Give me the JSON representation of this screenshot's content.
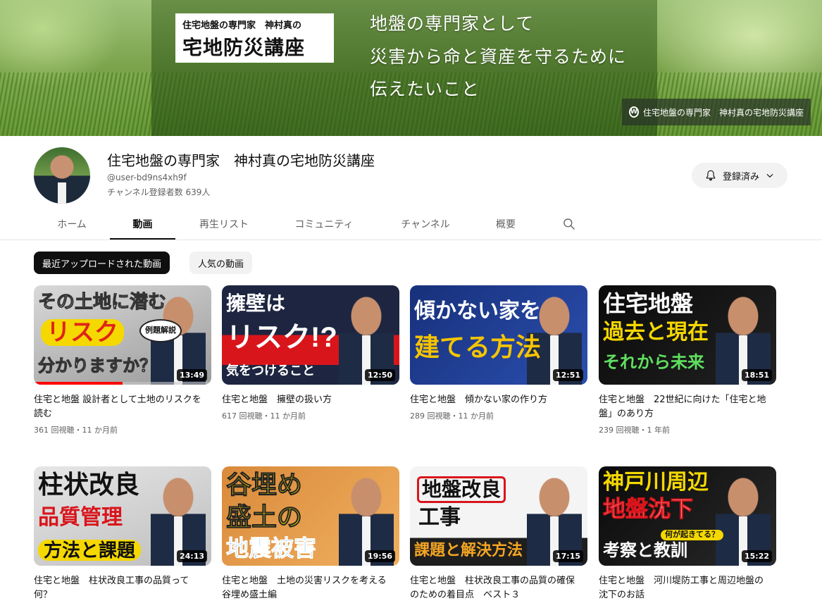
{
  "banner": {
    "logo_small": "住宅地盤の専門家　神村真の",
    "logo_big": "宅地防災講座",
    "tagline_lines": [
      "地盤の専門家として",
      "災害から命と資産を守るために",
      "伝えたいこと"
    ],
    "link_label": "住宅地盤の専門家　神村真の宅地防災講座",
    "link_icon": "wordpress-icon"
  },
  "channel": {
    "name": "住宅地盤の専門家　神村真の宅地防災講座",
    "handle": "@user-bd9ns4xh9f",
    "subscribers": "チャンネル登録者数 639人",
    "subscribe_label": "登録済み"
  },
  "tabs": [
    "ホーム",
    "動画",
    "再生リスト",
    "コミュニティ",
    "チャンネル",
    "概要"
  ],
  "active_tab": "動画",
  "chips": [
    "最近アップロードされた動画",
    "人気の動画"
  ],
  "videos": [
    {
      "thumb_lines": [
        "その土地に潜む",
        "リスク",
        "分かりますか？"
      ],
      "thumb_badge": "例題解説",
      "duration": "13:49",
      "title": "住宅と地盤 設計者として土地のリスクを読む",
      "meta": "361 回視聴・11 か月前",
      "progress": 0.5
    },
    {
      "thumb_lines": [
        "擁壁は",
        "リスク!?",
        "気をつけること"
      ],
      "duration": "12:50",
      "title": "住宅と地盤　擁壁の扱い方",
      "meta": "617 回視聴・11 か月前"
    },
    {
      "thumb_lines": [
        "傾かない家を",
        "建てる方法"
      ],
      "duration": "12:51",
      "title": "住宅と地盤　傾かない家の作り方",
      "meta": "289 回視聴・11 か月前"
    },
    {
      "thumb_lines": [
        "住宅地盤",
        "過去と現在",
        "それから未来"
      ],
      "duration": "18:51",
      "title": "住宅と地盤　22世紀に向けた「住宅と地盤」のあり方",
      "meta": "239 回視聴・1 年前"
    },
    {
      "thumb_lines": [
        "柱状改良",
        "品質管理",
        "方法と課題"
      ],
      "duration": "24:13",
      "title": "住宅と地盤　柱状改良工事の品質って何？",
      "meta": ""
    },
    {
      "thumb_lines": [
        "谷埋め",
        "盛土の",
        "地震被害"
      ],
      "duration": "19:56",
      "title": "住宅と地盤　土地の災害リスクを考える　谷埋め盛土編",
      "meta": ""
    },
    {
      "thumb_lines": [
        "地盤改良",
        "工事",
        "課題と解決方法"
      ],
      "duration": "17:15",
      "title": "住宅と地盤　柱状改良工事の品質の確保のための着目点　ベスト３",
      "meta": ""
    },
    {
      "thumb_lines": [
        "神戸川周辺",
        "地盤沈下",
        "何が起きてる？",
        "考察と教訓"
      ],
      "duration": "15:22",
      "title": "住宅と地盤　河川堤防工事と周辺地盤の沈下のお話",
      "meta": ""
    }
  ]
}
